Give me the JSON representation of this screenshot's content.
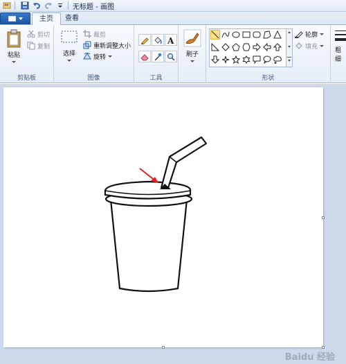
{
  "window": {
    "title": "无标题 - 画图"
  },
  "quick_access": [
    "save-icon",
    "undo-icon",
    "redo-icon",
    "customize-caret-icon"
  ],
  "tabs": [
    {
      "label": "主页",
      "active": true
    },
    {
      "label": "查看",
      "active": false
    }
  ],
  "clipboard": {
    "paste_label": "粘贴",
    "cut_label": "剪切",
    "copy_label": "复制",
    "group_label": "剪贴板"
  },
  "image": {
    "select_label": "选择",
    "crop_label": "裁剪",
    "resize_label": "重新调整大小",
    "rotate_label": "旋转",
    "group_label": "图像"
  },
  "tools": {
    "group_label": "工具",
    "items": [
      "pencil-icon",
      "fill-icon",
      "text-icon",
      "eraser-icon",
      "color-picker-icon",
      "magnifier-icon"
    ]
  },
  "brushes": {
    "label": "刷子"
  },
  "shapes": {
    "group_label": "形状",
    "outline_label": "轮廓",
    "fill_label": "填充"
  },
  "extra": {
    "label_line1": "粗",
    "label_line2": "细"
  },
  "colors": {
    "accent": "#2a62b1",
    "arrow": "#e02020",
    "workspace": "#ccd9ea"
  },
  "watermark": "Baidu 经验"
}
